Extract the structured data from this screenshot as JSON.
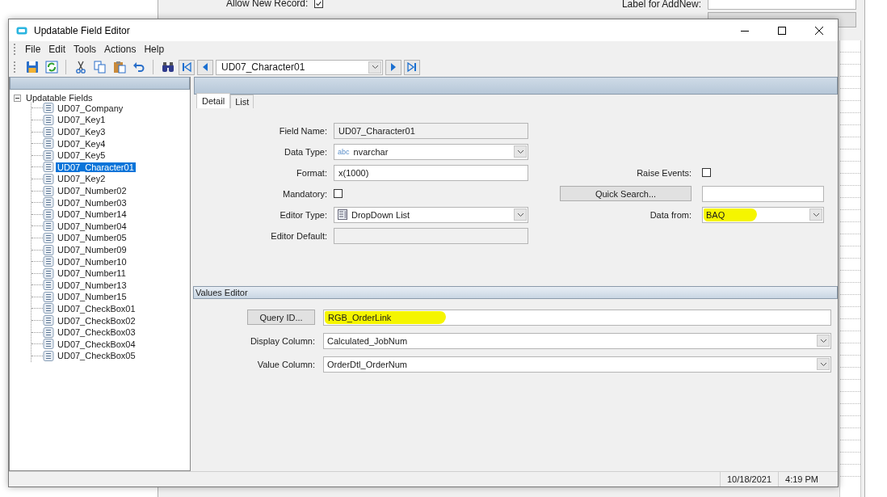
{
  "background_window": {
    "allow_new_record": {
      "label": "Allow New Record:",
      "checked": true
    },
    "label_for_addnew": {
      "label": "Label for AddNew:"
    }
  },
  "window": {
    "title": "Updatable Field Editor"
  },
  "menu": [
    "File",
    "Edit",
    "Tools",
    "Actions",
    "Help"
  ],
  "toolbar": {
    "record": "UD07_Character01"
  },
  "tree": {
    "label": "Updatable Fields",
    "expanded": true,
    "children": [
      {
        "label": "UD07_Company",
        "selected": false
      },
      {
        "label": "UD07_Key1",
        "selected": false
      },
      {
        "label": "UD07_Key3",
        "selected": false
      },
      {
        "label": "UD07_Key4",
        "selected": false
      },
      {
        "label": "UD07_Key5",
        "selected": false
      },
      {
        "label": "UD07_Character01",
        "selected": true
      },
      {
        "label": "UD07_Key2",
        "selected": false
      },
      {
        "label": "UD07_Number02",
        "selected": false
      },
      {
        "label": "UD07_Number03",
        "selected": false
      },
      {
        "label": "UD07_Number14",
        "selected": false
      },
      {
        "label": "UD07_Number04",
        "selected": false
      },
      {
        "label": "UD07_Number05",
        "selected": false
      },
      {
        "label": "UD07_Number09",
        "selected": false
      },
      {
        "label": "UD07_Number10",
        "selected": false
      },
      {
        "label": "UD07_Number11",
        "selected": false
      },
      {
        "label": "UD07_Number13",
        "selected": false
      },
      {
        "label": "UD07_Number15",
        "selected": false
      },
      {
        "label": "UD07_CheckBox01",
        "selected": false
      },
      {
        "label": "UD07_CheckBox02",
        "selected": false
      },
      {
        "label": "UD07_CheckBox03",
        "selected": false
      },
      {
        "label": "UD07_CheckBox04",
        "selected": false
      },
      {
        "label": "UD07_CheckBox05",
        "selected": false
      }
    ]
  },
  "tabs": [
    {
      "label": "Detail",
      "selected": true
    },
    {
      "label": "List",
      "selected": false
    }
  ],
  "detail_left": [
    {
      "kind": "readonly",
      "label": "Field Name:",
      "value": "UD07_Character01"
    },
    {
      "kind": "combo",
      "label": "Data Type:",
      "type_badge": "abc",
      "value": "nvarchar"
    },
    {
      "kind": "text",
      "label": "Format:",
      "value": "x(1000)"
    },
    {
      "kind": "checkbox",
      "label": "Mandatory:",
      "checked": false
    },
    {
      "kind": "icon_combo",
      "label": "Editor Type:",
      "value": "DropDown List"
    },
    {
      "kind": "readonly",
      "label": "Editor Default:"
    }
  ],
  "detail_right": [
    {
      "kind": "checkbox",
      "label": "Raise Events:",
      "checked": false
    },
    {
      "kind": "button_text",
      "label": "Quick Search..."
    },
    {
      "kind": "combo",
      "label": "Data from:",
      "value": "BAQ",
      "highlighted": true
    }
  ],
  "values_editor": {
    "title": "Values Editor",
    "rows": [
      {
        "kind": "button_text",
        "label": "Query ID...",
        "value": "RGB_OrderLink",
        "highlighted": true
      },
      {
        "kind": "combo",
        "label": "Display Column:",
        "value": "Calculated_JobNum"
      },
      {
        "kind": "combo",
        "label": "Value Column:",
        "value": "OrderDtl_OrderNum"
      }
    ]
  },
  "status_bar": {
    "date": "10/18/2021",
    "time": "4:19 PM"
  }
}
